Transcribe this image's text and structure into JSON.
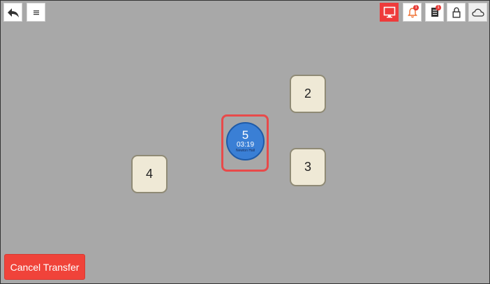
{
  "toolbar": {
    "left_buttons": [
      {
        "name": "back",
        "icon": "back-arrow-icon"
      },
      {
        "name": "menu",
        "icon": "menu-icon"
      }
    ],
    "right_buttons": [
      {
        "name": "display",
        "icon": "monitor-icon",
        "active": true
      },
      {
        "name": "notifications",
        "icon": "bell-icon",
        "badge": "1"
      },
      {
        "name": "orders",
        "icon": "document-icon",
        "badge": "1"
      },
      {
        "name": "lock",
        "icon": "lock-icon"
      },
      {
        "name": "cloud",
        "icon": "cloud-icon"
      }
    ]
  },
  "floor": {
    "tables": [
      {
        "number": "2"
      },
      {
        "number": "3"
      },
      {
        "number": "4"
      }
    ],
    "selected_table": {
      "number": "5",
      "timer": "03:19",
      "guest": "Newton Hall"
    }
  },
  "actions": {
    "cancel_transfer_label": "Cancel Transfer"
  },
  "colors": {
    "floor_bg": "#a8a8a8",
    "table_fill": "#efe9d6",
    "selected_table_fill": "#3a7fd5",
    "highlight": "#e84a4a",
    "danger": "#f0433a",
    "badge": "#e53935"
  }
}
